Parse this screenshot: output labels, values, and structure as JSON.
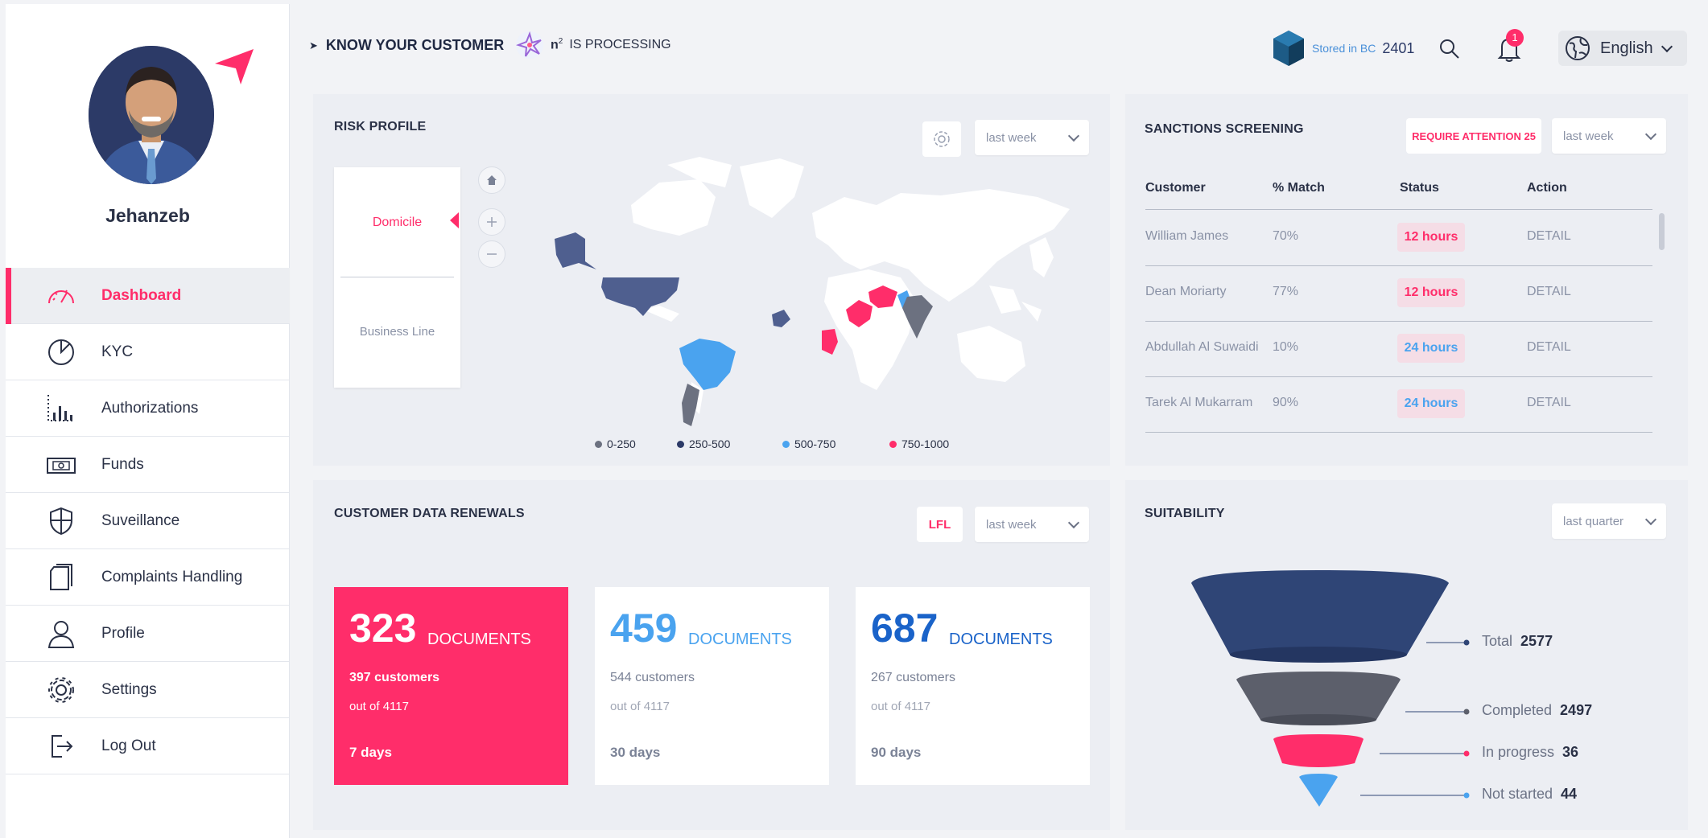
{
  "user": {
    "name": "Jehanzeb"
  },
  "nav": {
    "items": [
      {
        "label": "Dashboard",
        "icon": "gauge-icon",
        "active": true
      },
      {
        "label": "KYC",
        "icon": "pie-icon"
      },
      {
        "label": "Authorizations",
        "icon": "bar-chart-icon"
      },
      {
        "label": "Funds",
        "icon": "banknote-icon"
      },
      {
        "label": "Suveillance",
        "icon": "shield-icon"
      },
      {
        "label": "Complaints Handling",
        "icon": "document-icon"
      },
      {
        "label": "Profile",
        "icon": "user-icon"
      },
      {
        "label": "Settings",
        "icon": "gear-icon"
      },
      {
        "label": "Log Out",
        "icon": "logout-icon"
      }
    ]
  },
  "header": {
    "title": "KNOW YOUR CUSTOMER",
    "n2_base": "n",
    "n2_sup": "2",
    "n2_status": "IS PROCESSING",
    "bc_label": "Stored in BC",
    "bc_number": "2401",
    "notification_count": "1",
    "language": "English"
  },
  "risk_profile": {
    "title": "RISK PROFILE",
    "period": "last week",
    "toggle_a": "Domicile",
    "toggle_b": "Business Line",
    "legend": [
      {
        "label": "0-250",
        "color": "#6c7180"
      },
      {
        "label": "250-500",
        "color": "#2c3a67"
      },
      {
        "label": "500-750",
        "color": "#4aa3ef"
      },
      {
        "label": "750-1000",
        "color": "#ff2d6a"
      }
    ]
  },
  "sanctions": {
    "title": "SANCTIONS SCREENING",
    "attention_label": "REQUIRE ATTENTION",
    "attention_count": "25",
    "period": "last week",
    "columns": [
      "Customer",
      "% Match",
      "Status",
      "Action"
    ],
    "rows": [
      {
        "customer": "William James",
        "match": "70%",
        "status": "12 hours",
        "status_color": "#ff2d6a",
        "action": "DETAIL"
      },
      {
        "customer": "Dean Moriarty",
        "match": "77%",
        "status": "12 hours",
        "status_color": "#ff2d6a",
        "action": "DETAIL"
      },
      {
        "customer": "Abdullah Al Suwaidi",
        "match": "10%",
        "status": "24 hours",
        "status_color": "#4aa3ef",
        "action": "DETAIL"
      },
      {
        "customer": "Tarek Al Mukarram",
        "match": "90%",
        "status": "24 hours",
        "status_color": "#4aa3ef",
        "action": "DETAIL"
      }
    ]
  },
  "renewals": {
    "title": "CUSTOMER DATA RENEWALS",
    "lfl": "LFL",
    "period": "last week",
    "cards": [
      {
        "count": "323",
        "unit": "DOCUMENTS",
        "customers": "397 customers",
        "out_of": "out of 4117",
        "days": "7 days"
      },
      {
        "count": "459",
        "unit": "DOCUMENTS",
        "customers": "544 customers",
        "out_of": "out of 4117",
        "days": "30 days"
      },
      {
        "count": "687",
        "unit": "DOCUMENTS",
        "customers": "267 customers",
        "out_of": "out of 4117",
        "days": "90 days"
      }
    ]
  },
  "suitability": {
    "title": "SUITABILITY",
    "period": "last quarter",
    "levels": [
      {
        "label": "Total",
        "value": "2577",
        "color": "#2f4576"
      },
      {
        "label": "Completed",
        "value": "2497",
        "color": "#5c5f6b"
      },
      {
        "label": "In progress",
        "value": "36",
        "color": "#ff2d6a"
      },
      {
        "label": "Not started",
        "value": "44",
        "color": "#4aa3ef"
      }
    ]
  }
}
